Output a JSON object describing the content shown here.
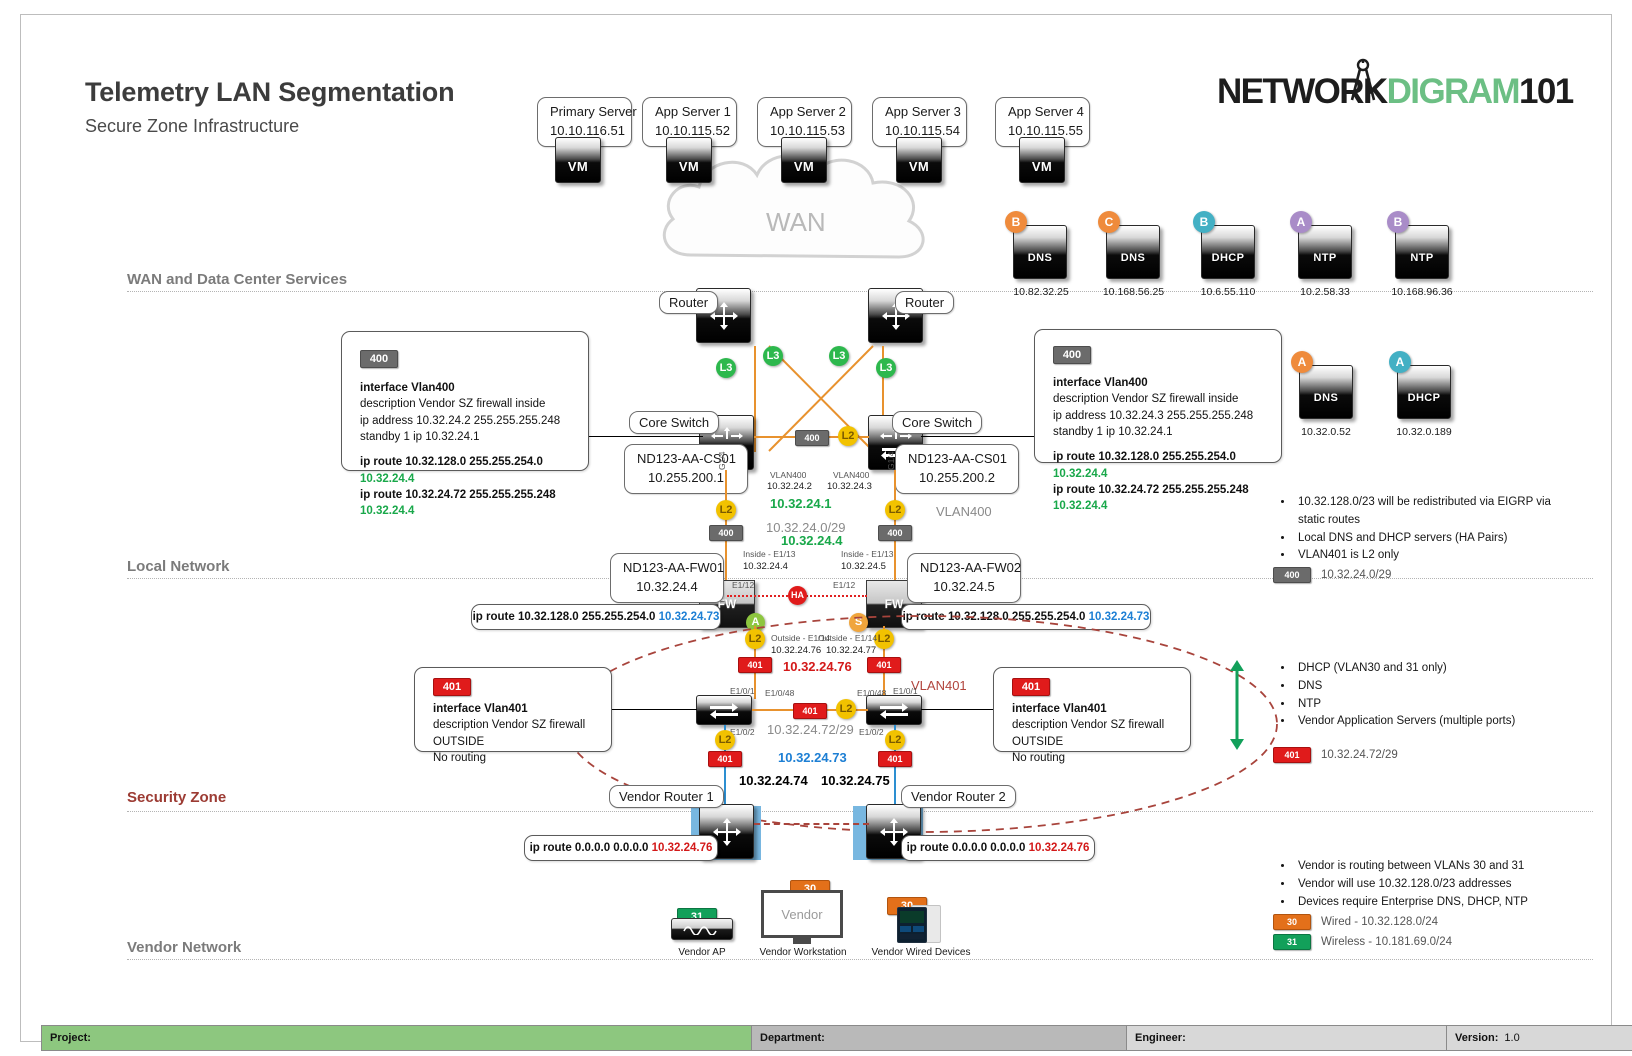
{
  "header": {
    "title": "Telemetry LAN Segmentation",
    "subtitle": "Secure Zone Infrastructure",
    "logo_part1": "NETWORK",
    "logo_part2": "DI",
    "logo_part3": "GRAM",
    "logo_part4": "101"
  },
  "sections": [
    {
      "label": "WAN and Data Center Services"
    },
    {
      "label": "Local Network"
    },
    {
      "label": "Security Zone"
    },
    {
      "label": "Vendor Network"
    }
  ],
  "wan": {
    "label": "WAN"
  },
  "servers": [
    {
      "name": "Primary Server",
      "ip": "10.10.116.51",
      "icon": "VM"
    },
    {
      "name": "App Server 1",
      "ip": "10.10.115.52",
      "icon": "VM"
    },
    {
      "name": "App Server 2",
      "ip": "10.10.115.53",
      "icon": "VM"
    },
    {
      "name": "App Server 3",
      "ip": "10.10.115.54",
      "icon": "VM"
    },
    {
      "name": "App Server 4",
      "ip": "10.10.115.55",
      "icon": "VM"
    }
  ],
  "services_top": [
    {
      "badge": "B",
      "label": "DNS",
      "ip": "10.82.32.25"
    },
    {
      "badge": "C",
      "label": "DNS",
      "ip": "10.168.56.25"
    },
    {
      "badge": "B",
      "label": "DHCP",
      "ip": "10.6.55.110"
    },
    {
      "badge": "A",
      "label": "NTP",
      "ip": "10.2.58.33"
    },
    {
      "badge": "B",
      "label": "NTP",
      "ip": "10.168.96.36"
    }
  ],
  "services_local": [
    {
      "badge": "A",
      "label": "DNS",
      "ip": "10.32.0.52"
    },
    {
      "badge": "A",
      "label": "DHCP",
      "ip": "10.32.0.189"
    }
  ],
  "routers": [
    {
      "label": "Router"
    },
    {
      "label": "Router"
    }
  ],
  "core_switches": [
    {
      "label": "Core Switch",
      "name": "ND123-AA-CS01",
      "ip": "10.255.200.1",
      "port": "G1/4",
      "vlan": "VLAN400",
      "vlan_ip": "10.32.24.2"
    },
    {
      "label": "Core Switch",
      "name": "ND123-AA-CS01",
      "ip": "10.255.200.2",
      "port": "G1/4",
      "vlan": "VLAN400",
      "vlan_ip": "10.32.24.3"
    }
  ],
  "firewalls": [
    {
      "name": "ND123-AA-FW01",
      "ip": "10.32.24.4",
      "inside": "Inside - E1/13",
      "inside_ip": "10.32.24.4",
      "ha_port": "E1/12",
      "outside": "Outside - E1/14",
      "outside_ip": "10.32.24.76",
      "state": "A",
      "route": "ip route 10.32.128.0 255.255.254.0 ",
      "route_nh": "10.32.24.73"
    },
    {
      "name": "ND123-AA-FW02",
      "ip": "10.32.24.5",
      "inside": "Inside - E1/13",
      "inside_ip": "10.32.24.5",
      "ha_port": "E1/12",
      "outside": "Outside - E1/14",
      "outside_ip": "10.32.24.77",
      "state": "S",
      "route": "ip route 10.32.128.0 255.255.254.0 ",
      "route_nh": "10.32.24.73"
    }
  ],
  "ha_label": "HA",
  "sz_switches": [
    {
      "p1": "E1/0/1",
      "p48": "E1/0/48",
      "p2": "E1/0/2"
    },
    {
      "p1": "E1/0/1",
      "p48": "E1/0/48",
      "p2": "E1/0/2"
    }
  ],
  "vendor_routers": [
    {
      "label": "Vendor Router 1",
      "ip": "10.32.24.74",
      "route": "ip route 0.0.0.0 0.0.0.0 ",
      "route_nh": "10.32.24.76"
    },
    {
      "label": "Vendor Router 2",
      "ip": "10.32.24.75",
      "route": "ip route 0.0.0.0 0.0.0.0 ",
      "route_nh": "10.32.24.76"
    }
  ],
  "config_left": {
    "tag": "400",
    "l1": "interface Vlan400",
    "l2": "description Vendor SZ firewall inside",
    "l3": "ip address 10.32.24.2 255.255.255.248",
    "l4": "standby 1 ip 10.32.24.1",
    "r1": "ip route 10.32.128.0 255.255.254.0 ",
    "r1nh": "10.32.24.4",
    "r2": "ip route 10.32.24.72 255.255.255.248 ",
    "r2nh": "10.32.24.4"
  },
  "config_right": {
    "tag": "400",
    "l1": "interface Vlan400",
    "l2": "description Vendor SZ firewall inside",
    "l3": "ip address 10.32.24.3 255.255.255.248",
    "l4": "standby 1 ip 10.32.24.1",
    "r1": "ip route 10.32.128.0 255.255.254.0 ",
    "r1nh": "10.32.24.4",
    "r2": "ip route 10.32.24.72 255.255.255.248 ",
    "r2nh": "10.32.24.4"
  },
  "config_sz_left": {
    "tag": "401",
    "l1": "interface Vlan401",
    "l2": " description Vendor SZ firewall OUTSIDE",
    "l3": "No routing"
  },
  "config_sz_right": {
    "tag": "401",
    "l1": "interface Vlan401",
    "l2": " description Vendor SZ firewall OUTSIDE",
    "l3": "No routing"
  },
  "inline_labels": {
    "vlan400_gw": "10.32.24.1",
    "vlan400_subnet": "10.32.24.0/29",
    "vlan400_fw_vip": "10.32.24.4",
    "vlan400_name": "VLAN400",
    "vlan401_vip": "10.32.24.76",
    "vlan401_name": "VLAN401",
    "vlan401_subnet": "10.32.24.72/29",
    "vlan401_gw": "10.32.24.73",
    "tag400": "400",
    "tag401": "401",
    "badge_l3": "L3",
    "badge_l2": "L2"
  },
  "notes_top": [
    "10.32.128.0/23 will be redistributed via EIGRP via static routes",
    "Local DNS and DHCP servers (HA Pairs)",
    "VLAN401 is L2 only"
  ],
  "notes_mid": [
    "DHCP (VLAN30 and 31 only)",
    "DNS",
    "NTP",
    "Vendor Application Servers (multiple ports)"
  ],
  "notes_bottom": [
    "Vendor is routing between VLANs 30 and 31",
    "Vendor will use 10.32.128.0/23 addresses",
    "Devices require Enterprise DNS, DHCP, NTP"
  ],
  "legend": [
    {
      "tag": "400",
      "text": "10.32.24.0/29",
      "color": "#6b6b6b"
    },
    {
      "tag": "401",
      "text": "10.32.24.72/29",
      "color": "#e01b1b"
    },
    {
      "tag": "30",
      "text": "Wired - 10.32.128.0/24",
      "color": "#e3701a"
    },
    {
      "tag": "31",
      "text": "Wireless - 10.181.69.0/24",
      "color": "#12a05a"
    }
  ],
  "vendor_devices": [
    {
      "tag": "31",
      "label": "Vendor AP"
    },
    {
      "tag": "30",
      "label": "Vendor Workstation",
      "screen": "Vendor"
    },
    {
      "tag": "30",
      "label": "Vendor Wired Devices"
    }
  ],
  "footer": {
    "project_label": "Project:",
    "project_value": "",
    "department_label": "Department:",
    "department_value": "",
    "engineer_label": "Engineer:",
    "engineer_value": "",
    "version_label": "Version:",
    "version_value": "1.0"
  }
}
